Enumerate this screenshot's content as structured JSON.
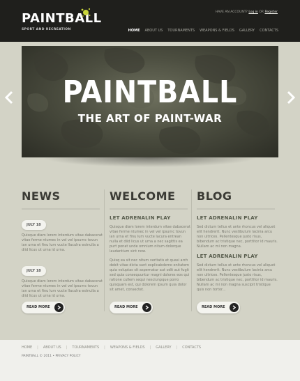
{
  "header": {
    "logo": "PAINTBALL",
    "tagline": "SPORT AND RECREATION",
    "account_prefix": "HAVE AN ACCOUNT?",
    "login": "Log in",
    "or": "OR",
    "register": "Register",
    "nav": [
      "HOME",
      "ABOUT US",
      "TOURNAMENTS",
      "WEAPONS & FIELDS",
      "GALLERY",
      "CONTACTS"
    ],
    "active_nav": "HOME",
    "accent_color": "#c9d63a"
  },
  "hero": {
    "title": "PAINTBALL",
    "subtitle": "THE ART OF PAINT-WAR",
    "prev_icon": "chevron-left-icon",
    "next_icon": "chevron-right-icon"
  },
  "news": {
    "title": "NEWS",
    "items": [
      {
        "date": "JULY 18",
        "text": "Quisque diam lorem interdum vitae dabacerat vitae ferme ntumec in vel vel ipsumc tovun ian urna et finu lum vucte llaculra estnulla a diid licus ut urna id urna."
      },
      {
        "date": "JULY 18",
        "text": "Quisque diam lorem interdum vitae dabacerat vitae ferme ntumec in vel vel ipsumc tovun ian urna et finu lum vucte llaculra estnulla a diid licus ut urna id urna."
      }
    ],
    "read_more": "READ MORE"
  },
  "welcome": {
    "title": "WELCOME",
    "subhead": "LET ADRENALIN PLAY",
    "p1": "Quisque diam lorem interdum vitae dabacerat vitae ferme ntumec in vel vel ipsumc tovun ian urna et finu lum vucte lacura entrean nulla et diid licus ut urna a nec sagittis ea purt ponat unde omnium nitum dolorque laudantium sint now.",
    "p2": "Quisq ea sit nec nitum veritatis et quasi arch debit vitae dicta sunt explicabdemo enitatem quia voluptas sit aspernatur aut odit aut fugit sed quia consequuntur magni dolores eos qui ratione cullem sequi nesciunpque porro quisquam est, qui dolorem ipsum quia dolor sit amet, consectet.",
    "read_more": "READ MORE"
  },
  "blog": {
    "title": "BLOG",
    "items": [
      {
        "subhead": "LET ADRENALIN PLAY",
        "text": "Sed dictum tellus et ante rhoncus vel aliquet elit hendrerit. Nunc vestibulum lacinia arcu non ultrices. Pellentesque justo risus, bibendum ac tristique nec, porttitor id mauris. Nullam ac mi non magna."
      },
      {
        "subhead": "LET ADRENALIN PLAY",
        "text": "Sed dictum tellus et ante rhoncus vel aliquet elit hendrerit. Nunc vestibulum lacinia arcu non ultrices. Pellentesque justo risus, bibendum ac tristique nec, porttitor id mauris. Nullam ac mi non magna suscipit tristique quis non tortor..."
      }
    ],
    "read_more": "READ MORE"
  },
  "footer": {
    "nav": [
      "HOME",
      "ABOUT US",
      "TOURNAMENTS",
      "WEAPONS & FIELDS",
      "GALLERY",
      "CONTACTS"
    ],
    "separator": "|",
    "copyright": "PAINTBALL © 2011 • PRIVACY POLICY"
  }
}
